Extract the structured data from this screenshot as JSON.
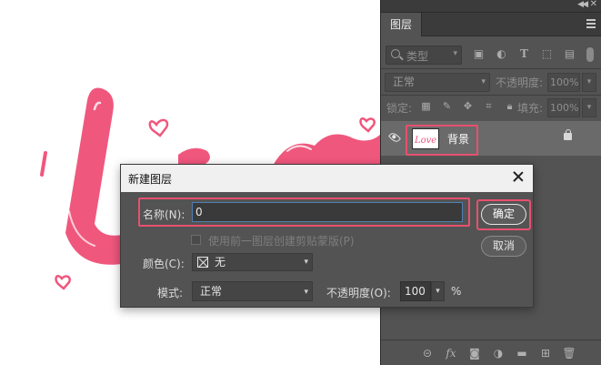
{
  "panel": {
    "tab_label": "图层",
    "filter": {
      "kind_label": "类型"
    },
    "blend_mode": "正常",
    "opacity_label": "不透明度:",
    "opacity_value": "100%",
    "lock_label": "锁定:",
    "fill_label": "填充:",
    "fill_value": "100%",
    "layer": {
      "name": "背景",
      "thumb_text": "Love"
    },
    "filter_icons": [
      "image-filter-icon",
      "adjustment-filter-icon",
      "type-filter-icon",
      "shape-filter-icon",
      "smartobject-filter-icon"
    ],
    "lock_icons": [
      "lock-transparent-icon",
      "lock-image-icon",
      "lock-position-icon",
      "lock-artboard-icon",
      "lock-all-icon"
    ],
    "footer_icons": [
      "link-layers-icon",
      "fx-icon",
      "mask-icon",
      "adjustment-layer-icon",
      "group-icon",
      "new-layer-icon",
      "delete-icon"
    ]
  },
  "dialog": {
    "title": "新建图层",
    "name_label": "名称(N):",
    "name_value": "0",
    "ok_label": "确定",
    "cancel_label": "取消",
    "clip_label": "使用前一图层创建剪贴蒙版(P)",
    "color_label": "颜色(C):",
    "color_value": "无",
    "mode_label": "模式:",
    "mode_value": "正常",
    "opacity_label": "不透明度(O):",
    "opacity_value": "100",
    "opacity_unit": "%"
  },
  "colors": {
    "highlight": "#e8506e",
    "artwork_pink": "#f0577d",
    "panel_bg": "#535353"
  }
}
